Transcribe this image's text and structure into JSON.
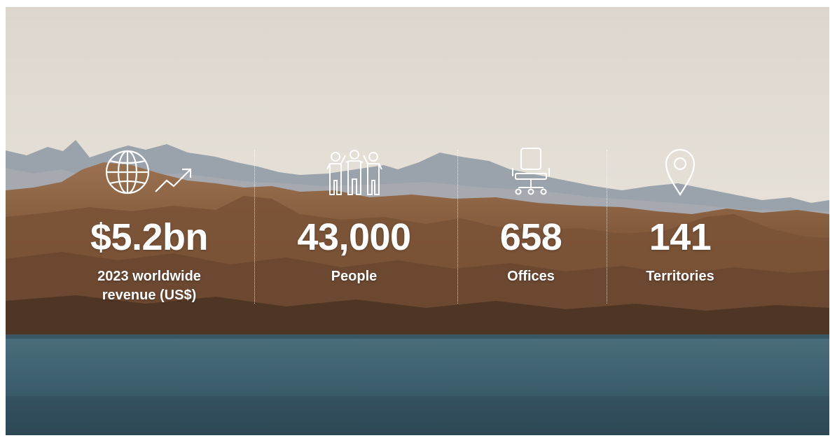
{
  "stats": [
    {
      "icon": "globe-growth-icon",
      "value": "$5.2bn",
      "label": "2023 worldwide revenue (US$)"
    },
    {
      "icon": "people-group-icon",
      "value": "43,000",
      "label": "People"
    },
    {
      "icon": "office-chair-icon",
      "value": "658",
      "label": "Offices"
    },
    {
      "icon": "location-pin-icon",
      "value": "141",
      "label": "Territories"
    }
  ],
  "colors": {
    "text": "#ffffff",
    "sky": "#e6e1d9",
    "mountain": "#8a6040",
    "water": "#3f6272"
  }
}
